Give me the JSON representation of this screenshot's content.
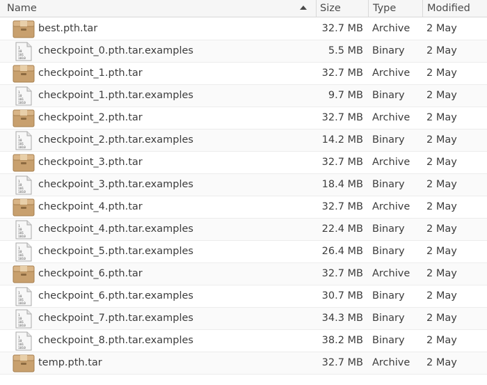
{
  "columns": {
    "name": "Name",
    "size": "Size",
    "type": "Type",
    "modified": "Modified"
  },
  "icons": {
    "archive": "archive-box-icon",
    "binary": "binary-file-icon",
    "sort": "sort-ascending-icon"
  },
  "files": [
    {
      "name": "best.pth.tar",
      "size": "32.7 MB",
      "type": "Archive",
      "modified": "2 May",
      "icon": "archive"
    },
    {
      "name": "checkpoint_0.pth.tar.examples",
      "size": "5.5 MB",
      "type": "Binary",
      "modified": "2 May",
      "icon": "binary"
    },
    {
      "name": "checkpoint_1.pth.tar",
      "size": "32.7 MB",
      "type": "Archive",
      "modified": "2 May",
      "icon": "archive"
    },
    {
      "name": "checkpoint_1.pth.tar.examples",
      "size": "9.7 MB",
      "type": "Binary",
      "modified": "2 May",
      "icon": "binary"
    },
    {
      "name": "checkpoint_2.pth.tar",
      "size": "32.7 MB",
      "type": "Archive",
      "modified": "2 May",
      "icon": "archive"
    },
    {
      "name": "checkpoint_2.pth.tar.examples",
      "size": "14.2 MB",
      "type": "Binary",
      "modified": "2 May",
      "icon": "binary"
    },
    {
      "name": "checkpoint_3.pth.tar",
      "size": "32.7 MB",
      "type": "Archive",
      "modified": "2 May",
      "icon": "archive"
    },
    {
      "name": "checkpoint_3.pth.tar.examples",
      "size": "18.4 MB",
      "type": "Binary",
      "modified": "2 May",
      "icon": "binary"
    },
    {
      "name": "checkpoint_4.pth.tar",
      "size": "32.7 MB",
      "type": "Archive",
      "modified": "2 May",
      "icon": "archive"
    },
    {
      "name": "checkpoint_4.pth.tar.examples",
      "size": "22.4 MB",
      "type": "Binary",
      "modified": "2 May",
      "icon": "binary"
    },
    {
      "name": "checkpoint_5.pth.tar.examples",
      "size": "26.4 MB",
      "type": "Binary",
      "modified": "2 May",
      "icon": "binary"
    },
    {
      "name": "checkpoint_6.pth.tar",
      "size": "32.7 MB",
      "type": "Archive",
      "modified": "2 May",
      "icon": "archive"
    },
    {
      "name": "checkpoint_6.pth.tar.examples",
      "size": "30.7 MB",
      "type": "Binary",
      "modified": "2 May",
      "icon": "binary"
    },
    {
      "name": "checkpoint_7.pth.tar.examples",
      "size": "34.3 MB",
      "type": "Binary",
      "modified": "2 May",
      "icon": "binary"
    },
    {
      "name": "checkpoint_8.pth.tar.examples",
      "size": "38.2 MB",
      "type": "Binary",
      "modified": "2 May",
      "icon": "binary"
    },
    {
      "name": "temp.pth.tar",
      "size": "32.7 MB",
      "type": "Archive",
      "modified": "2 May",
      "icon": "archive"
    }
  ]
}
